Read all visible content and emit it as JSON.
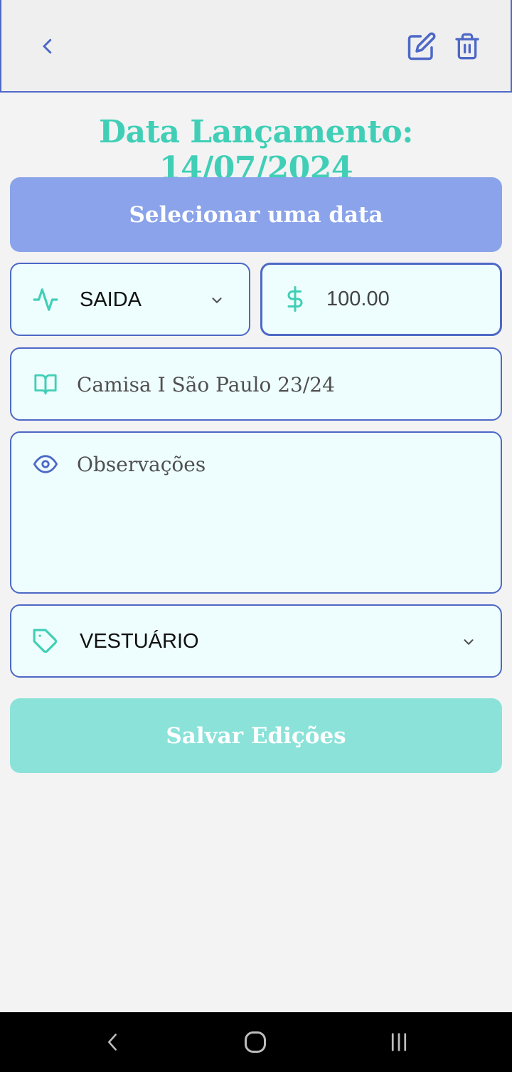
{
  "header": {
    "back_icon": "chevron-left-icon",
    "edit_icon": "edit-icon",
    "delete_icon": "trash-icon"
  },
  "title": "Data Lançamento: 14/07/2024",
  "date_button_label": "Selecionar uma data",
  "type_select": {
    "icon": "activity-icon",
    "value": "SAIDA"
  },
  "amount": {
    "icon": "dollar-icon",
    "value": "100.00"
  },
  "description": {
    "icon": "book-icon",
    "value": "Camisa I São Paulo 23/24"
  },
  "observations": {
    "icon": "eye-icon",
    "placeholder": "Observações"
  },
  "category_select": {
    "icon": "tag-icon",
    "value": "VESTUÁRIO"
  },
  "save_button_label": "Salvar Edições",
  "colors": {
    "accent_teal": "#40cfb6",
    "accent_blue": "#4d68c6",
    "date_button": "#8aa3ea",
    "save_button": "#8be2d9"
  },
  "system_nav": {
    "back_icon": "nav-back-icon",
    "home_icon": "nav-home-icon",
    "recents_icon": "nav-recents-icon"
  }
}
